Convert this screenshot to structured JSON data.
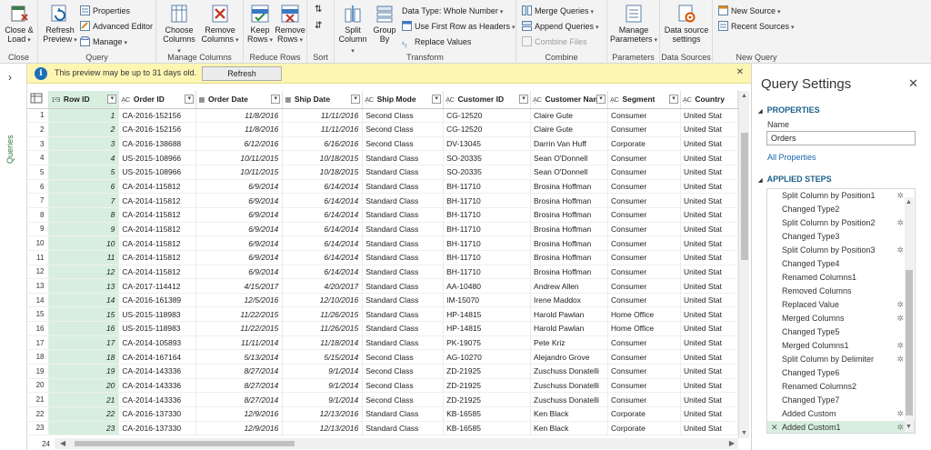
{
  "ribbon": {
    "close": {
      "close_load": "Close &",
      "close_load2": "Load",
      "group": "Close"
    },
    "query": {
      "refresh": "Refresh",
      "refresh2": "Preview",
      "properties": "Properties",
      "advanced_editor": "Advanced Editor",
      "manage": "Manage",
      "group": "Query"
    },
    "manage_columns": {
      "choose": "Choose",
      "choose2": "Columns",
      "remove": "Remove",
      "remove2": "Columns",
      "group": "Manage Columns"
    },
    "reduce_rows": {
      "keep": "Keep",
      "keep2": "Rows",
      "remove": "Remove",
      "remove2": "Rows",
      "group": "Reduce Rows"
    },
    "sort": {
      "group": "Sort"
    },
    "transform": {
      "split": "Split",
      "split2": "Column",
      "group_by": "Group",
      "group_by2": "By",
      "data_type": "Data Type: Whole Number",
      "first_row": "Use First Row as Headers",
      "replace": "Replace Values",
      "group": "Transform"
    },
    "combine": {
      "merge": "Merge Queries",
      "append": "Append Queries",
      "combine_files": "Combine Files",
      "group": "Combine"
    },
    "parameters": {
      "manage": "Manage",
      "manage2": "Parameters",
      "group": "Parameters"
    },
    "data_sources": {
      "settings": "Data source",
      "settings2": "settings",
      "group": "Data Sources"
    },
    "new_query": {
      "new_source": "New Source",
      "recent_sources": "Recent Sources",
      "group": "New Query"
    }
  },
  "infobar": {
    "text": "This preview may be up to 31 days old.",
    "button": "Refresh"
  },
  "left_pane": {
    "label": "Queries"
  },
  "grid": {
    "headers": [
      {
        "type": "1²3",
        "name": "Row ID"
      },
      {
        "type": "A᷊C",
        "name": "Order ID"
      },
      {
        "type": "▦",
        "name": "Order Date"
      },
      {
        "type": "▦",
        "name": "Ship Date"
      },
      {
        "type": "A᷊C",
        "name": "Ship Mode"
      },
      {
        "type": "A᷊C",
        "name": "Customer ID"
      },
      {
        "type": "A᷊C",
        "name": "Customer Name"
      },
      {
        "type": "A᷊C",
        "name": "Segment"
      },
      {
        "type": "A᷊C",
        "name": "Country"
      }
    ],
    "rows": [
      [
        "1",
        "1",
        "CA-2016-152156",
        "11/8/2016",
        "11/11/2016",
        "Second Class",
        "CG-12520",
        "Claire Gute",
        "Consumer",
        "United Stat"
      ],
      [
        "2",
        "2",
        "CA-2016-152156",
        "11/8/2016",
        "11/11/2016",
        "Second Class",
        "CG-12520",
        "Claire Gute",
        "Consumer",
        "United Stat"
      ],
      [
        "3",
        "3",
        "CA-2016-138688",
        "6/12/2016",
        "6/16/2016",
        "Second Class",
        "DV-13045",
        "Darrin Van Huff",
        "Corporate",
        "United Stat"
      ],
      [
        "4",
        "4",
        "US-2015-108966",
        "10/11/2015",
        "10/18/2015",
        "Standard Class",
        "SO-20335",
        "Sean O'Donnell",
        "Consumer",
        "United Stat"
      ],
      [
        "5",
        "5",
        "US-2015-108966",
        "10/11/2015",
        "10/18/2015",
        "Standard Class",
        "SO-20335",
        "Sean O'Donnell",
        "Consumer",
        "United Stat"
      ],
      [
        "6",
        "6",
        "CA-2014-115812",
        "6/9/2014",
        "6/14/2014",
        "Standard Class",
        "BH-11710",
        "Brosina Hoffman",
        "Consumer",
        "United Stat"
      ],
      [
        "7",
        "7",
        "CA-2014-115812",
        "6/9/2014",
        "6/14/2014",
        "Standard Class",
        "BH-11710",
        "Brosina Hoffman",
        "Consumer",
        "United Stat"
      ],
      [
        "8",
        "8",
        "CA-2014-115812",
        "6/9/2014",
        "6/14/2014",
        "Standard Class",
        "BH-11710",
        "Brosina Hoffman",
        "Consumer",
        "United Stat"
      ],
      [
        "9",
        "9",
        "CA-2014-115812",
        "6/9/2014",
        "6/14/2014",
        "Standard Class",
        "BH-11710",
        "Brosina Hoffman",
        "Consumer",
        "United Stat"
      ],
      [
        "10",
        "10",
        "CA-2014-115812",
        "6/9/2014",
        "6/14/2014",
        "Standard Class",
        "BH-11710",
        "Brosina Hoffman",
        "Consumer",
        "United Stat"
      ],
      [
        "11",
        "11",
        "CA-2014-115812",
        "6/9/2014",
        "6/14/2014",
        "Standard Class",
        "BH-11710",
        "Brosina Hoffman",
        "Consumer",
        "United Stat"
      ],
      [
        "12",
        "12",
        "CA-2014-115812",
        "6/9/2014",
        "6/14/2014",
        "Standard Class",
        "BH-11710",
        "Brosina Hoffman",
        "Consumer",
        "United Stat"
      ],
      [
        "13",
        "13",
        "CA-2017-114412",
        "4/15/2017",
        "4/20/2017",
        "Standard Class",
        "AA-10480",
        "Andrew Allen",
        "Consumer",
        "United Stat"
      ],
      [
        "14",
        "14",
        "CA-2016-161389",
        "12/5/2016",
        "12/10/2016",
        "Standard Class",
        "IM-15070",
        "Irene Maddox",
        "Consumer",
        "United Stat"
      ],
      [
        "15",
        "15",
        "US-2015-118983",
        "11/22/2015",
        "11/26/2015",
        "Standard Class",
        "HP-14815",
        "Harold Pawlan",
        "Home Office",
        "United Stat"
      ],
      [
        "16",
        "16",
        "US-2015-118983",
        "11/22/2015",
        "11/26/2015",
        "Standard Class",
        "HP-14815",
        "Harold Pawlan",
        "Home Office",
        "United Stat"
      ],
      [
        "17",
        "17",
        "CA-2014-105893",
        "11/11/2014",
        "11/18/2014",
        "Standard Class",
        "PK-19075",
        "Pete Kriz",
        "Consumer",
        "United Stat"
      ],
      [
        "18",
        "18",
        "CA-2014-167164",
        "5/13/2014",
        "5/15/2014",
        "Second Class",
        "AG-10270",
        "Alejandro Grove",
        "Consumer",
        "United Stat"
      ],
      [
        "19",
        "19",
        "CA-2014-143336",
        "8/27/2014",
        "9/1/2014",
        "Second Class",
        "ZD-21925",
        "Zuschuss Donatelli",
        "Consumer",
        "United Stat"
      ],
      [
        "20",
        "20",
        "CA-2014-143336",
        "8/27/2014",
        "9/1/2014",
        "Second Class",
        "ZD-21925",
        "Zuschuss Donatelli",
        "Consumer",
        "United Stat"
      ],
      [
        "21",
        "21",
        "CA-2014-143336",
        "8/27/2014",
        "9/1/2014",
        "Second Class",
        "ZD-21925",
        "Zuschuss Donatelli",
        "Consumer",
        "United Stat"
      ],
      [
        "22",
        "22",
        "CA-2016-137330",
        "12/9/2016",
        "12/13/2016",
        "Standard Class",
        "KB-16585",
        "Ken Black",
        "Corporate",
        "United Stat"
      ],
      [
        "23",
        "23",
        "CA-2016-137330",
        "12/9/2016",
        "12/13/2016",
        "Standard Class",
        "KB-16585",
        "Ken Black",
        "Corporate",
        "United Stat"
      ]
    ],
    "partial_row_number": "24"
  },
  "settings": {
    "title": "Query Settings",
    "properties_heading": "PROPERTIES",
    "name_label": "Name",
    "name_value": "Orders",
    "all_properties": "All Properties",
    "applied_steps_heading": "APPLIED STEPS",
    "steps": [
      {
        "label": "Split Column by Position1",
        "gear": true
      },
      {
        "label": "Changed Type2",
        "gear": false
      },
      {
        "label": "Split Column by Position2",
        "gear": true
      },
      {
        "label": "Changed Type3",
        "gear": false
      },
      {
        "label": "Split Column by Position3",
        "gear": true
      },
      {
        "label": "Changed Type4",
        "gear": false
      },
      {
        "label": "Renamed Columns1",
        "gear": false
      },
      {
        "label": "Removed Columns",
        "gear": false
      },
      {
        "label": "Replaced Value",
        "gear": true
      },
      {
        "label": "Merged Columns",
        "gear": true
      },
      {
        "label": "Changed Type5",
        "gear": false
      },
      {
        "label": "Merged Columns1",
        "gear": true
      },
      {
        "label": "Split Column by Delimiter",
        "gear": true
      },
      {
        "label": "Changed Type6",
        "gear": false
      },
      {
        "label": "Renamed Columns2",
        "gear": false
      },
      {
        "label": "Changed Type7",
        "gear": false
      },
      {
        "label": "Added Custom",
        "gear": true
      },
      {
        "label": "Added Custom1",
        "gear": true,
        "selected": true
      }
    ]
  },
  "colors": {
    "accent_green": "#d8efe0",
    "link_blue": "#1a66b0",
    "heading_blue": "#1c5f8c",
    "info_yellow": "#fdf6b3"
  }
}
